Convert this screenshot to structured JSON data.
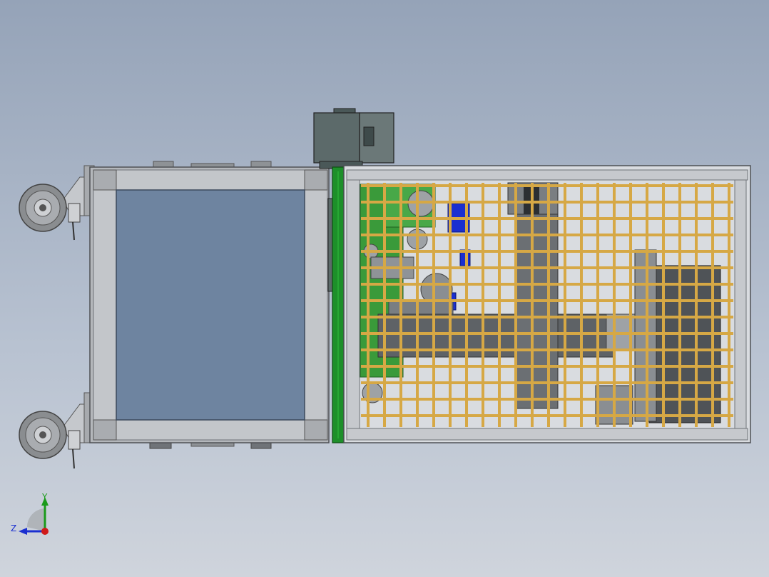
{
  "viewport": {
    "background_top": "#95a3b8",
    "background_bottom": "#cfd4dc"
  },
  "colors": {
    "frame_steel": "#b4b7bb",
    "frame_dark": "#6f7378",
    "glass_panel": "#6e84a0",
    "mesh_orange": "#d6a845",
    "green_plate": "#1d8f2a",
    "pcb_green": "#3a9a3a",
    "motor_gray": "#5c6a6a",
    "component_blue": "#1a2fd0",
    "wheel_gray": "#8a8d90"
  },
  "parts": {
    "left_cart": "cart-frame",
    "right_cage": "mesh-cage",
    "motor": "gear-motor",
    "casters": [
      "caster-top",
      "caster-bottom"
    ]
  },
  "triad": {
    "y_label": "Y",
    "z_label": "Z",
    "y_color": "#1a9a1a",
    "z_color": "#1a2fd0",
    "x_color": "#d01a1a"
  }
}
